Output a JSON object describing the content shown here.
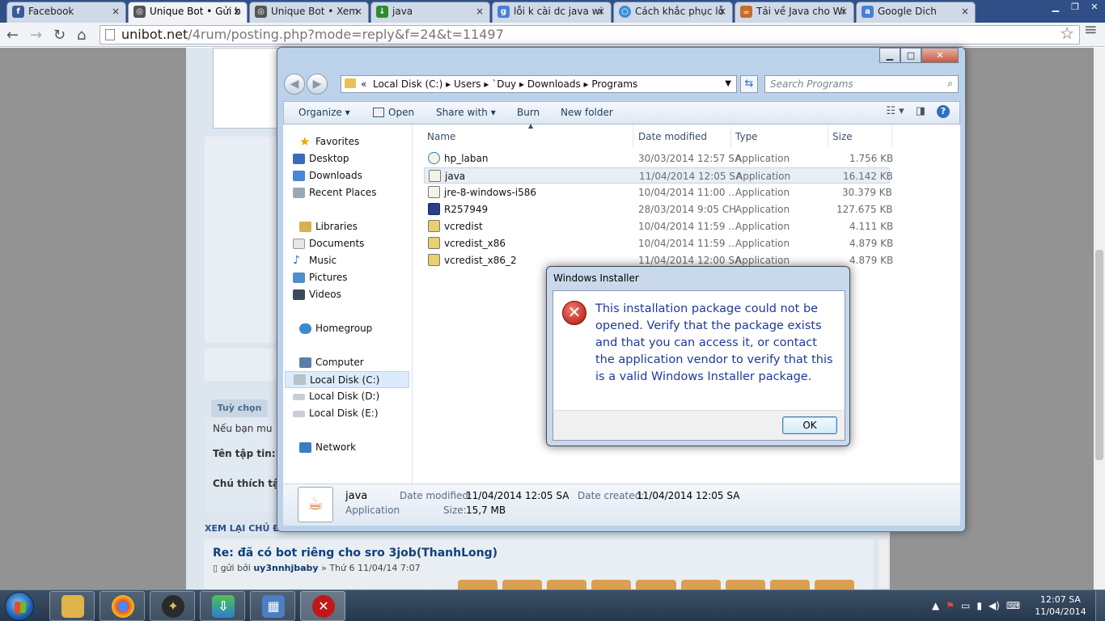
{
  "chrome": {
    "tabs": [
      {
        "label": "Facebook",
        "icon": "facebook-icon",
        "color": "#3b5998"
      },
      {
        "label": "Unique Bot • Gửi b",
        "icon": "unibot-icon",
        "color": "#555555",
        "active": true
      },
      {
        "label": "Unique Bot • Xem",
        "icon": "unibot-icon",
        "color": "#555555"
      },
      {
        "label": "java",
        "icon": "download-icon",
        "color": "#2e8b2e"
      },
      {
        "label": "lỗi k cài dc java wi",
        "icon": "google-icon",
        "color": "#4a7fd6"
      },
      {
        "label": "Cách khắc phục lỗ",
        "icon": "chrome-page-icon",
        "color": "#3a8fd8"
      },
      {
        "label": "Tải về Java cho Wi",
        "icon": "java-icon",
        "color": "#c76b2a"
      },
      {
        "label": "Google Dich",
        "icon": "translate-icon",
        "color": "#4a7fd6"
      }
    ],
    "tab_close": "×",
    "address": {
      "host": "unibot.net",
      "path": "/4rum/posting.php?mode=reply&f=24&t=11497"
    }
  },
  "page": {
    "tab_label": "Tuỳ chọn",
    "lines": [
      "Nếu bạn mu",
      "Tên tập tin:",
      "Chú thích tậ"
    ],
    "review": "XEM LẠI CHỦ ĐỀ",
    "post_title": "Re: đã có bot riêng cho sro 3job(ThanhLong)",
    "post_meta_prefix": "gửi bởi",
    "post_author": "uy3nnhjbaby",
    "post_meta_suffix": "» Thứ 6 11/04/14 7:07"
  },
  "explorer": {
    "breadcrumb": [
      "«",
      "Local Disk (C:)",
      "Users",
      "`Duy",
      "Downloads",
      "Programs"
    ],
    "search_placeholder": "Search Programs",
    "commands": {
      "organize": "Organize",
      "open": "Open",
      "share_with": "Share with",
      "burn": "Burn",
      "new_folder": "New folder"
    },
    "nav": {
      "favorites": "Favorites",
      "desktop": "Desktop",
      "downloads": "Downloads",
      "recent": "Recent Places",
      "libraries": "Libraries",
      "documents": "Documents",
      "music": "Music",
      "pictures": "Pictures",
      "videos": "Videos",
      "homegroup": "Homegroup",
      "computer": "Computer",
      "disk_c": "Local Disk (C:)",
      "disk_d": "Local Disk (D:)",
      "disk_e": "Local Disk (E:)",
      "network": "Network"
    },
    "columns": {
      "name": "Name",
      "date": "Date modified",
      "type": "Type",
      "size": "Size"
    },
    "files": [
      {
        "name": "hp_laban",
        "date": "30/03/2014 12:57 SA",
        "type": "Application",
        "size": "1.756 KB"
      },
      {
        "name": "java",
        "date": "11/04/2014 12:05 SA",
        "type": "Application",
        "size": "16.142 KB"
      },
      {
        "name": "jre-8-windows-i586",
        "date": "10/04/2014 11:00 ...",
        "type": "Application",
        "size": "30.379 KB"
      },
      {
        "name": "R257949",
        "date": "28/03/2014 9:05 CH",
        "type": "Application",
        "size": "127.675 KB"
      },
      {
        "name": "vcredist",
        "date": "10/04/2014 11:59 ...",
        "type": "Application",
        "size": "4.111 KB"
      },
      {
        "name": "vcredist_x86",
        "date": "10/04/2014 11:59 ...",
        "type": "Application",
        "size": "4.879 KB"
      },
      {
        "name": "vcredist_x86_2",
        "date": "11/04/2014 12:00 SA",
        "type": "Application",
        "size": "4.879 KB"
      }
    ],
    "status": {
      "name": "java",
      "type": "Application",
      "date_modified_label": "Date modified:",
      "date_modified": "11/04/2014 12:05 SA",
      "date_created_label": "Date created:",
      "date_created": "11/04/2014 12:05 SA",
      "size_label": "Size:",
      "size": "15,7 MB"
    }
  },
  "dialog": {
    "title": "Windows Installer",
    "message": "This installation package could not be opened.  Verify that the package exists and that you can access it, or contact the application vendor to verify that this is a valid Windows Installer package.",
    "ok": "OK"
  },
  "taskbar": {
    "time": "12:07 SA",
    "date": "11/04/2014"
  }
}
